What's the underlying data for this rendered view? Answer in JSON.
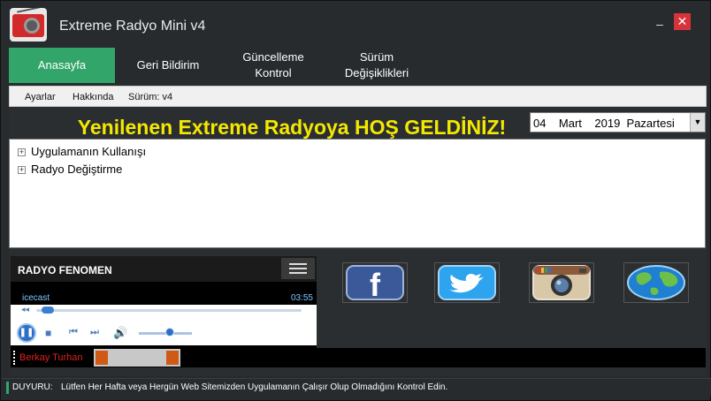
{
  "window": {
    "title": "Extreme Radyo Mini v4",
    "minimize_glyph": "–",
    "close_glyph": "✕"
  },
  "tabs": [
    {
      "label": "Anasayfa",
      "active": true
    },
    {
      "label": "Geri Bildirim",
      "active": false
    },
    {
      "label": "Güncelleme Kontrol",
      "active": false
    },
    {
      "label": "Sürüm Değişiklikleri",
      "active": false
    }
  ],
  "menu": {
    "items": [
      "Ayarlar",
      "Hakkında",
      "Sürüm: v4"
    ]
  },
  "welcome": {
    "text": "Yenilenen Extreme Radyoya HOŞ GELDİNİZ!",
    "color": "#f5e800"
  },
  "date": {
    "day": "04",
    "month": "Mart",
    "year": "2019",
    "weekday": "Pazartesi",
    "dropdown_glyph": "▼"
  },
  "tree": {
    "nodes": [
      "Uygulamanın Kullanışı",
      "Radyo Değiştirme"
    ],
    "expander_glyph": "+"
  },
  "player": {
    "title": "RADYO FENOMEN",
    "source": "icecast",
    "time": "03:55",
    "progress": 0.02,
    "volume": 0.6,
    "ticker_name": "Berkay Turhan"
  },
  "social": [
    {
      "name": "facebook",
      "icon": "facebook-icon"
    },
    {
      "name": "twitter",
      "icon": "twitter-icon"
    },
    {
      "name": "instagram",
      "icon": "instagram-icon"
    },
    {
      "name": "website",
      "icon": "globe-icon"
    }
  ],
  "status": {
    "label": "DUYURU:",
    "message": "Lütfen Her Hafta veya Hergün Web Sitemizden Uygulamanın Çalışır Olup Olmadığını Kontrol Edin."
  },
  "colors": {
    "accent": "#32a56a",
    "background": "#272b2d",
    "close": "#d6343a"
  }
}
